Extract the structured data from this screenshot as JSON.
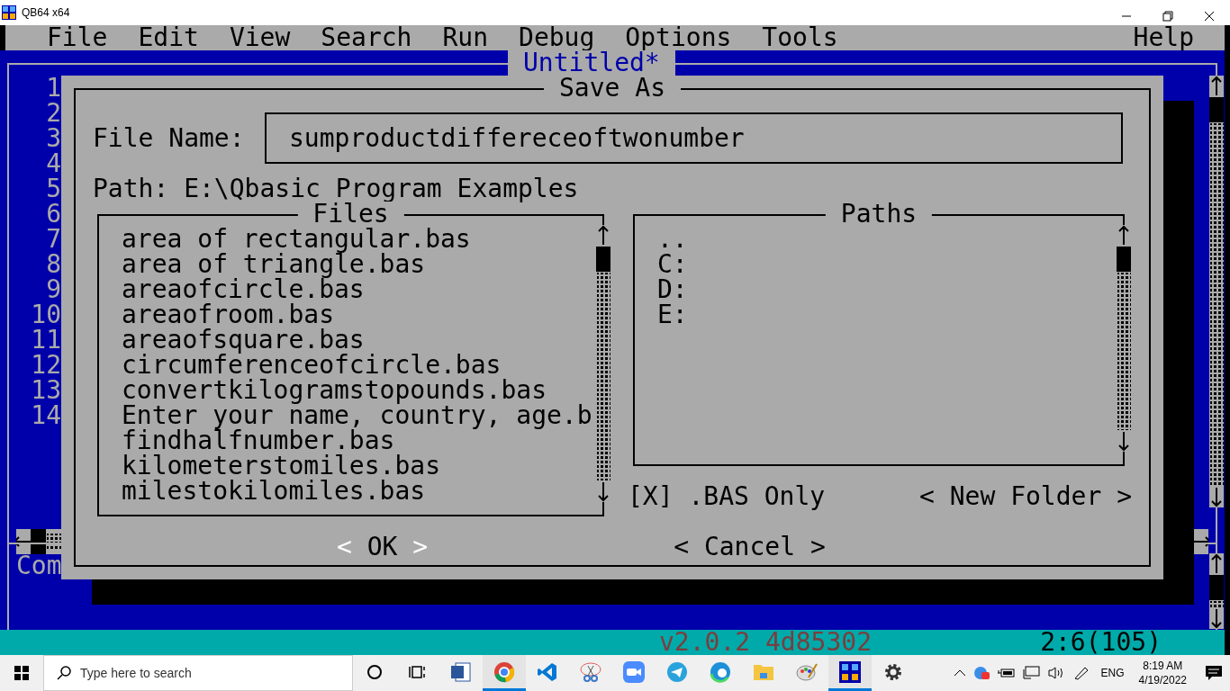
{
  "window": {
    "title": "QB64 x64"
  },
  "menu": {
    "left": [
      {
        "label": "File"
      },
      {
        "label": "Edit"
      },
      {
        "label": "View"
      },
      {
        "label": "Search"
      },
      {
        "label": "Run"
      },
      {
        "label": "Debug"
      },
      {
        "label": "Options"
      },
      {
        "label": "Tools"
      }
    ],
    "right": [
      {
        "label": "Help"
      }
    ]
  },
  "editor": {
    "title": "Untitled*",
    "line_numbers": [
      "1",
      "2",
      "3",
      "4",
      "5",
      "6",
      "7",
      "8",
      "9",
      "10",
      "11",
      "12",
      "13",
      "14"
    ],
    "immediate_label": "Com"
  },
  "dialog": {
    "title": "Save As",
    "file_name_label": "File Name:",
    "file_name_value": "sumproductdiffereceoftwonumber",
    "path": "Path: E:\\Qbasic Program Examples",
    "files": {
      "title": "Files",
      "items": [
        {
          "label": "area of rectangular.bas"
        },
        {
          "label": "area of triangle.bas"
        },
        {
          "label": "areaofcircle.bas"
        },
        {
          "label": "areaofroom.bas"
        },
        {
          "label": "areaofsquare.bas"
        },
        {
          "label": "circumferenceofcircle.bas"
        },
        {
          "label": "convertkilogramstopounds.bas"
        },
        {
          "label": "Enter your name, country, age.b"
        },
        {
          "label": "findhalfnumber.bas"
        },
        {
          "label": "kilometerstomiles.bas"
        },
        {
          "label": "milestokilomiles.bas"
        }
      ]
    },
    "paths": {
      "title": "Paths",
      "items": [
        {
          "label": ".."
        },
        {
          "label": "C:"
        },
        {
          "label": "D:"
        },
        {
          "label": "E:"
        }
      ]
    },
    "bas_only": {
      "box_open": "[",
      "mark": "X",
      "box_close": "]",
      "checked": true,
      "label": ".BAS Only"
    },
    "new_folder": {
      "left": "<",
      "label": "New Folder",
      "right": ">",
      "focused": false
    },
    "buttons": [
      {
        "left": "<",
        "label": "OK",
        "right": ">",
        "focused": true
      },
      {
        "left": "<",
        "label": "Cancel",
        "right": ">",
        "focused": false
      }
    ]
  },
  "status_bar": {
    "version": "v2.0.2 4d85302",
    "position": "2:6(105)"
  },
  "taskbar": {
    "search_placeholder": "Type here to search",
    "apps": [
      {
        "kind": "circle",
        "running": false
      },
      {
        "kind": "taskview",
        "running": false
      },
      {
        "kind": "document",
        "running": false
      },
      {
        "kind": "browser",
        "running": true
      },
      {
        "kind": "editor",
        "running": false
      },
      {
        "kind": "scissors",
        "running": false
      },
      {
        "kind": "camera",
        "running": false
      },
      {
        "kind": "plane",
        "running": false
      },
      {
        "kind": "wave",
        "running": false
      },
      {
        "kind": "folder",
        "running": false
      },
      {
        "kind": "palette",
        "running": false
      },
      {
        "kind": "grid",
        "running": true
      },
      {
        "kind": "gear",
        "running": false
      }
    ],
    "language": "ENG",
    "time": "8:19 AM",
    "date": "4/19/2022"
  }
}
